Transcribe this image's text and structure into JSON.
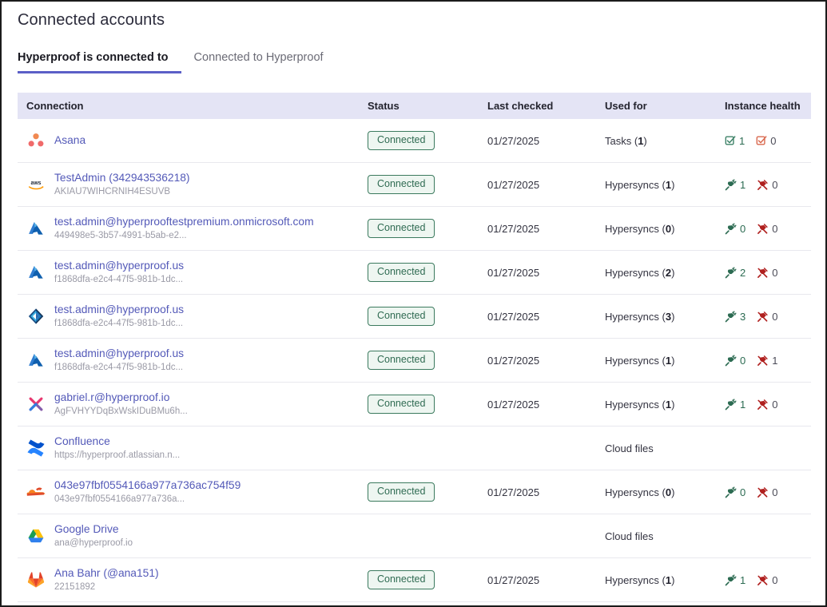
{
  "header": {
    "title": "Connected accounts"
  },
  "tabs": [
    {
      "label": "Hyperproof is connected to",
      "active": true
    },
    {
      "label": "Connected to Hyperproof",
      "active": false
    }
  ],
  "table": {
    "columns": [
      {
        "key": "connection",
        "label": "Connection"
      },
      {
        "key": "status",
        "label": "Status"
      },
      {
        "key": "last_checked",
        "label": "Last checked"
      },
      {
        "key": "used_for",
        "label": "Used for"
      },
      {
        "key": "instance_health",
        "label": "Instance health"
      }
    ],
    "rows": [
      {
        "icon": "asana-icon",
        "name": "Asana",
        "sub": "",
        "status": "Connected",
        "last_checked": "01/27/2025",
        "used_for_label": "Tasks",
        "used_for_count": "1",
        "health_style": "task",
        "health_ok": "1",
        "health_bad": "0"
      },
      {
        "icon": "aws-icon",
        "name": "TestAdmin (342943536218)",
        "sub": "AKIAU7WIHCRNIH4ESUVB",
        "status": "Connected",
        "last_checked": "01/27/2025",
        "used_for_label": "Hypersyncs",
        "used_for_count": "1",
        "health_style": "plug",
        "health_ok": "1",
        "health_bad": "0"
      },
      {
        "icon": "azure-icon",
        "name": "test.admin@hyperprooftestpremium.onmicrosoft.com",
        "sub": "449498e5-3b57-4991-b5ab-e2...",
        "status": "Connected",
        "last_checked": "01/27/2025",
        "used_for_label": "Hypersyncs",
        "used_for_count": "0",
        "health_style": "plug",
        "health_ok": "0",
        "health_bad": "0"
      },
      {
        "icon": "azure-icon",
        "name": "test.admin@hyperproof.us",
        "sub": "f1868dfa-e2c4-47f5-981b-1dc...",
        "status": "Connected",
        "last_checked": "01/27/2025",
        "used_for_label": "Hypersyncs",
        "used_for_count": "2",
        "health_style": "plug",
        "health_ok": "2",
        "health_bad": "0"
      },
      {
        "icon": "azure-devops-icon",
        "name": "test.admin@hyperproof.us",
        "sub": "f1868dfa-e2c4-47f5-981b-1dc...",
        "status": "Connected",
        "last_checked": "01/27/2025",
        "used_for_label": "Hypersyncs",
        "used_for_count": "3",
        "health_style": "plug",
        "health_ok": "3",
        "health_bad": "0"
      },
      {
        "icon": "azure-icon",
        "name": "test.admin@hyperproof.us",
        "sub": "f1868dfa-e2c4-47f5-981b-1dc...",
        "status": "Connected",
        "last_checked": "01/27/2025",
        "used_for_label": "Hypersyncs",
        "used_for_count": "1",
        "health_style": "plug",
        "health_ok": "0",
        "health_bad": "1"
      },
      {
        "icon": "cisco-x-icon",
        "name": "gabriel.r@hyperproof.io",
        "sub": "AgFVHYYDqBxWskIDuBMu6h...",
        "status": "Connected",
        "last_checked": "01/27/2025",
        "used_for_label": "Hypersyncs",
        "used_for_count": "1",
        "health_style": "plug",
        "health_ok": "1",
        "health_bad": "0"
      },
      {
        "icon": "confluence-icon",
        "name": "Confluence",
        "sub": "https://hyperproof.atlassian.n...",
        "status": "",
        "last_checked": "",
        "used_for_label": "Cloud files",
        "used_for_count": "",
        "health_style": "none",
        "health_ok": "",
        "health_bad": ""
      },
      {
        "icon": "cloudflare-icon",
        "name": "043e97fbf0554166a977a736ac754f59",
        "sub": "043e97fbf0554166a977a736a...",
        "status": "Connected",
        "last_checked": "01/27/2025",
        "used_for_label": "Hypersyncs",
        "used_for_count": "0",
        "health_style": "plug",
        "health_ok": "0",
        "health_bad": "0"
      },
      {
        "icon": "google-drive-icon",
        "name": "Google Drive",
        "sub": "ana@hyperproof.io",
        "status": "",
        "last_checked": "",
        "used_for_label": "Cloud files",
        "used_for_count": "",
        "health_style": "none",
        "health_ok": "",
        "health_bad": ""
      },
      {
        "icon": "gitlab-icon",
        "name": "Ana Bahr (@ana151)",
        "sub": "22151892",
        "status": "Connected",
        "last_checked": "01/27/2025",
        "used_for_label": "Hypersyncs",
        "used_for_count": "1",
        "health_style": "plug",
        "health_ok": "1",
        "health_bad": "0"
      }
    ]
  },
  "colors": {
    "tab_active_underline": "#5b5fc7",
    "header_bg": "#e4e4f5",
    "link": "#5359b8",
    "badge_text": "#2f6b52",
    "badge_border": "#3b7a5e",
    "health_ok": "#2c6b52",
    "health_bad": "#b0201f"
  }
}
